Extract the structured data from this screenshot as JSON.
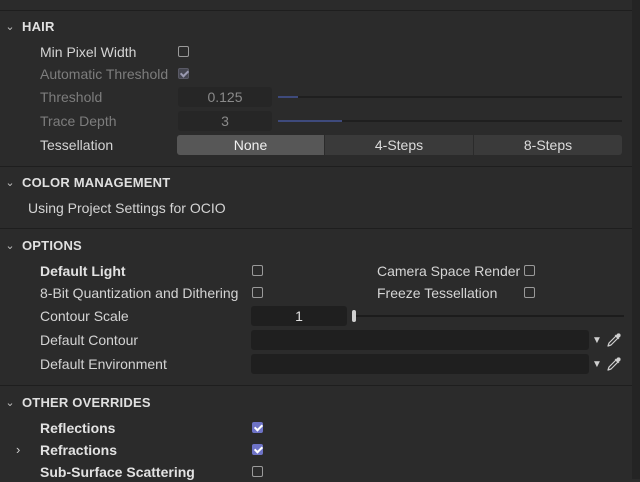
{
  "hair": {
    "title": "HAIR",
    "min_pixel_width": {
      "label": "Min Pixel Width",
      "checked": false
    },
    "automatic_threshold": {
      "label": "Automatic Threshold",
      "checked": true
    },
    "threshold": {
      "label": "Threshold",
      "value": "0.125",
      "fraction": 0.08
    },
    "trace_depth": {
      "label": "Trace Depth",
      "value": "3",
      "fraction": 0.25
    },
    "tessellation": {
      "label": "Tessellation",
      "options": [
        "None",
        "4-Steps",
        "8-Steps"
      ],
      "selected": "None"
    }
  },
  "color_management": {
    "title": "COLOR MANAGEMENT",
    "info": "Using Project Settings for OCIO"
  },
  "options": {
    "title": "OPTIONS",
    "default_light": {
      "label": "Default Light",
      "checked": false
    },
    "camera_space_render": {
      "label": "Camera Space Render",
      "checked": false
    },
    "quantization": {
      "label": "8-Bit Quantization and Dithering",
      "checked": false
    },
    "freeze_tessellation": {
      "label": "Freeze Tessellation",
      "checked": false
    },
    "contour_scale": {
      "label": "Contour Scale",
      "value": "1",
      "fraction": 0.0
    },
    "default_contour": {
      "label": "Default Contour",
      "value": ""
    },
    "default_environment": {
      "label": "Default Environment",
      "value": ""
    }
  },
  "other_overrides": {
    "title": "OTHER OVERRIDES",
    "reflections": {
      "label": "Reflections",
      "checked": true
    },
    "refractions": {
      "label": "Refractions",
      "checked": true
    },
    "sss": {
      "label": "Sub-Surface Scattering",
      "checked": false
    }
  },
  "icons": {
    "section_collapse": "chevron-down-icon",
    "row_expand": "chevron-right-icon",
    "dropdown": "caret-down-icon",
    "picker": "eyedropper-icon"
  },
  "colors": {
    "accent": "#6e73c6",
    "background": "#2b2b2b",
    "field": "#1f1f1f",
    "slider_fill": "#3e4a7c"
  }
}
